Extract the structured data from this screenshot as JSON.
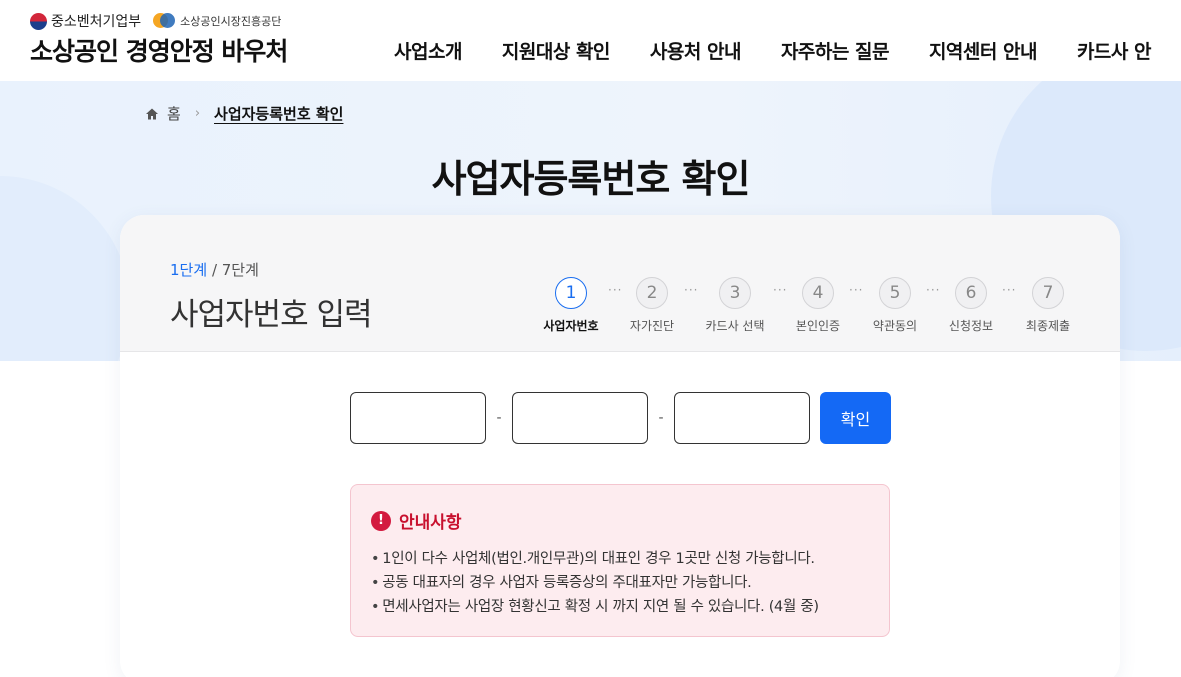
{
  "header": {
    "ministry_logo": "중소벤처기업부",
    "agency_logo": "소상공인시장진흥공단",
    "site_title": "소상공인 경영안정 바우처",
    "nav": [
      {
        "label": "사업소개"
      },
      {
        "label": "지원대상 확인"
      },
      {
        "label": "사용처 안내"
      },
      {
        "label": "자주하는 질문"
      },
      {
        "label": "지역센터 안내"
      },
      {
        "label": "카드사 안"
      }
    ]
  },
  "breadcrumb": {
    "home": "홈",
    "current": "사업자등록번호 확인"
  },
  "page_title": "사업자등록번호 확인",
  "step_header": {
    "current_step": "1단계",
    "total_steps": "/ 7단계",
    "title": "사업자번호 입력",
    "steps": [
      {
        "number": "1",
        "label": "사업자번호"
      },
      {
        "number": "2",
        "label": "자가진단"
      },
      {
        "number": "3",
        "label": "카드사 선택"
      },
      {
        "number": "4",
        "label": "본인인증"
      },
      {
        "number": "5",
        "label": "약관동의"
      },
      {
        "number": "6",
        "label": "신청정보"
      },
      {
        "number": "7",
        "label": "최종제출"
      }
    ],
    "separator": "···"
  },
  "form": {
    "part1_value": "",
    "part2_value": "",
    "part3_value": "",
    "dash": "-",
    "confirm_label": "확인"
  },
  "notice": {
    "icon_glyph": "!",
    "title": "안내사항",
    "items": [
      "1인이 다수 사업체(법인.개인무관)의 대표인 경우 1곳만 신청 가능합니다.",
      "공동 대표자의 경우 사업자 등록증상의 주대표자만 가능합니다.",
      "면세사업자는 사업장 현황신고 확정 시 까지 지연 될 수 있습니다. (4월 중)"
    ]
  },
  "colors": {
    "accent": "#1469f5",
    "active_step": "#1a6ef0",
    "notice_bg": "#fdecef",
    "notice_title": "#c8102e"
  }
}
